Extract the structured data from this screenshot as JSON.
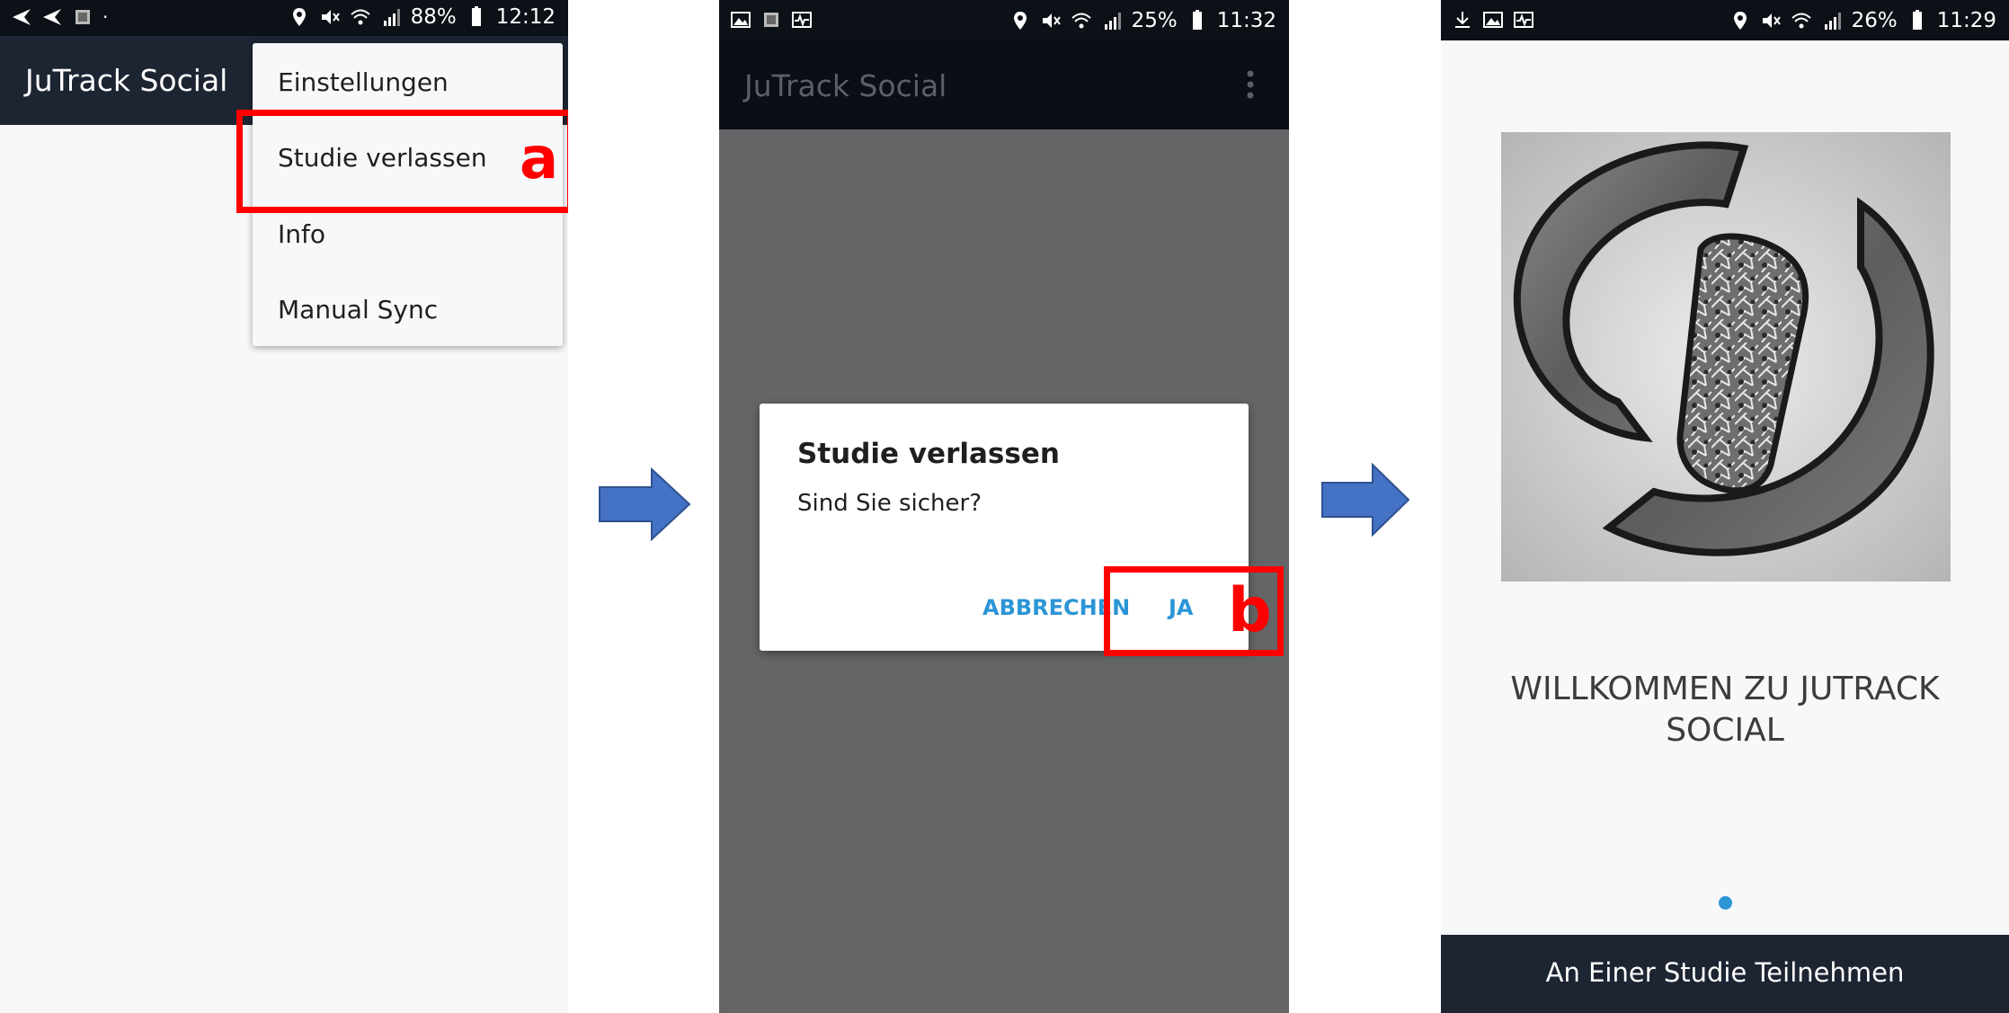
{
  "app_name": "JuTrack Social",
  "screens": [
    {
      "status": {
        "battery": "88%",
        "time": "12:12"
      },
      "menu_items": [
        "Einstellungen",
        "Studie verlassen",
        "Info",
        "Manual Sync"
      ],
      "annotation": "a"
    },
    {
      "status": {
        "battery": "25%",
        "time": "11:32"
      },
      "dialog": {
        "title": "Studie verlassen",
        "message": "Sind Sie sicher?",
        "cancel_label": "ABBRECHEN",
        "confirm_label": "JA"
      },
      "annotation": "b"
    },
    {
      "status": {
        "battery": "26%",
        "time": "11:29"
      },
      "welcome_line1": "WILLKOMMEN ZU JUTRACK",
      "welcome_line2": "SOCIAL",
      "join_button_label": "An Einer Studie Teilnehmen",
      "page_indicator": {
        "current": 1,
        "total": 1
      }
    }
  ],
  "colors": {
    "appbar": "#1d2533",
    "status_bar": "#0c1017",
    "annotation_red": "#ff0000",
    "arrow_blue": "#4472c4",
    "button_blue": "#2b95d6"
  }
}
